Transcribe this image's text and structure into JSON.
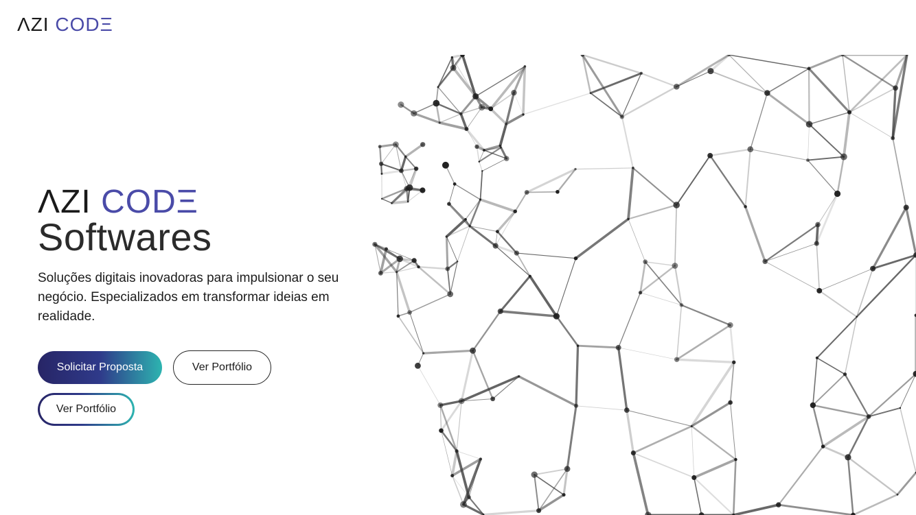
{
  "brand": {
    "logo_part1": "ΛZI",
    "logo_part2": "CODΞ",
    "color_dark": "#1a1a1a",
    "color_accent": "#4a4ba8"
  },
  "hero": {
    "title_part1": "ΛZI",
    "title_part2": "CODΞ",
    "subtitle": "Softwares",
    "description": "Soluções digitais inovadoras para impulsionar o seu negócio. Especializados em transformar ideias em realidade.",
    "primary_button": "Solicitar Proposta",
    "secondary_button": "Ver Portfólio",
    "tertiary_button": "Ver Portfólio",
    "gradient_start": "#272566",
    "gradient_end": "#2db4b0"
  },
  "illustration": {
    "icon": "network-mesh-icon"
  }
}
